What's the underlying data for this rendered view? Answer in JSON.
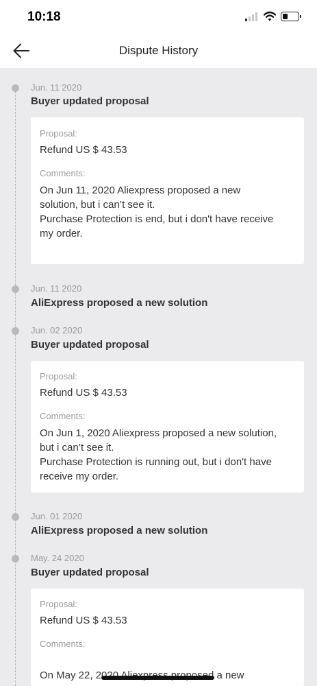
{
  "status_bar": {
    "time": "10:18"
  },
  "header": {
    "title": "Dispute History"
  },
  "events": [
    {
      "date": "Jun. 11 2020",
      "title": "Buyer updated proposal",
      "proposal_label": "Proposal:",
      "proposal": "Refund US $ 43.53",
      "comments_label": "Comments:",
      "comments": "On Jun 11, 2020 Aliexpress proposed a new\nsolution, but i can’t see it.\nPurchase Protection is end, but i don't have receive\nmy order."
    },
    {
      "date": "Jun. 11 2020",
      "title": "AliExpress proposed a new solution"
    },
    {
      "date": "Jun. 02 2020",
      "title": "Buyer updated proposal",
      "proposal_label": "Proposal:",
      "proposal": "Refund US $ 43.53",
      "comments_label": "Comments:",
      "comments": "On Jun 1, 2020 Aliexpress proposed a new solution,\nbut i can’t see it.\nPurchase Protection is running out, but i don't have\nreceive my order."
    },
    {
      "date": "Jun. 01 2020",
      "title": "AliExpress proposed a new solution"
    },
    {
      "date": "May. 24 2020",
      "title": "Buyer updated proposal",
      "proposal_label": "Proposal:",
      "proposal": "Refund US $ 43.53",
      "comments_label": "Comments:",
      "comments": "On May 22, 2020 Aliexpress proposed a new"
    }
  ]
}
